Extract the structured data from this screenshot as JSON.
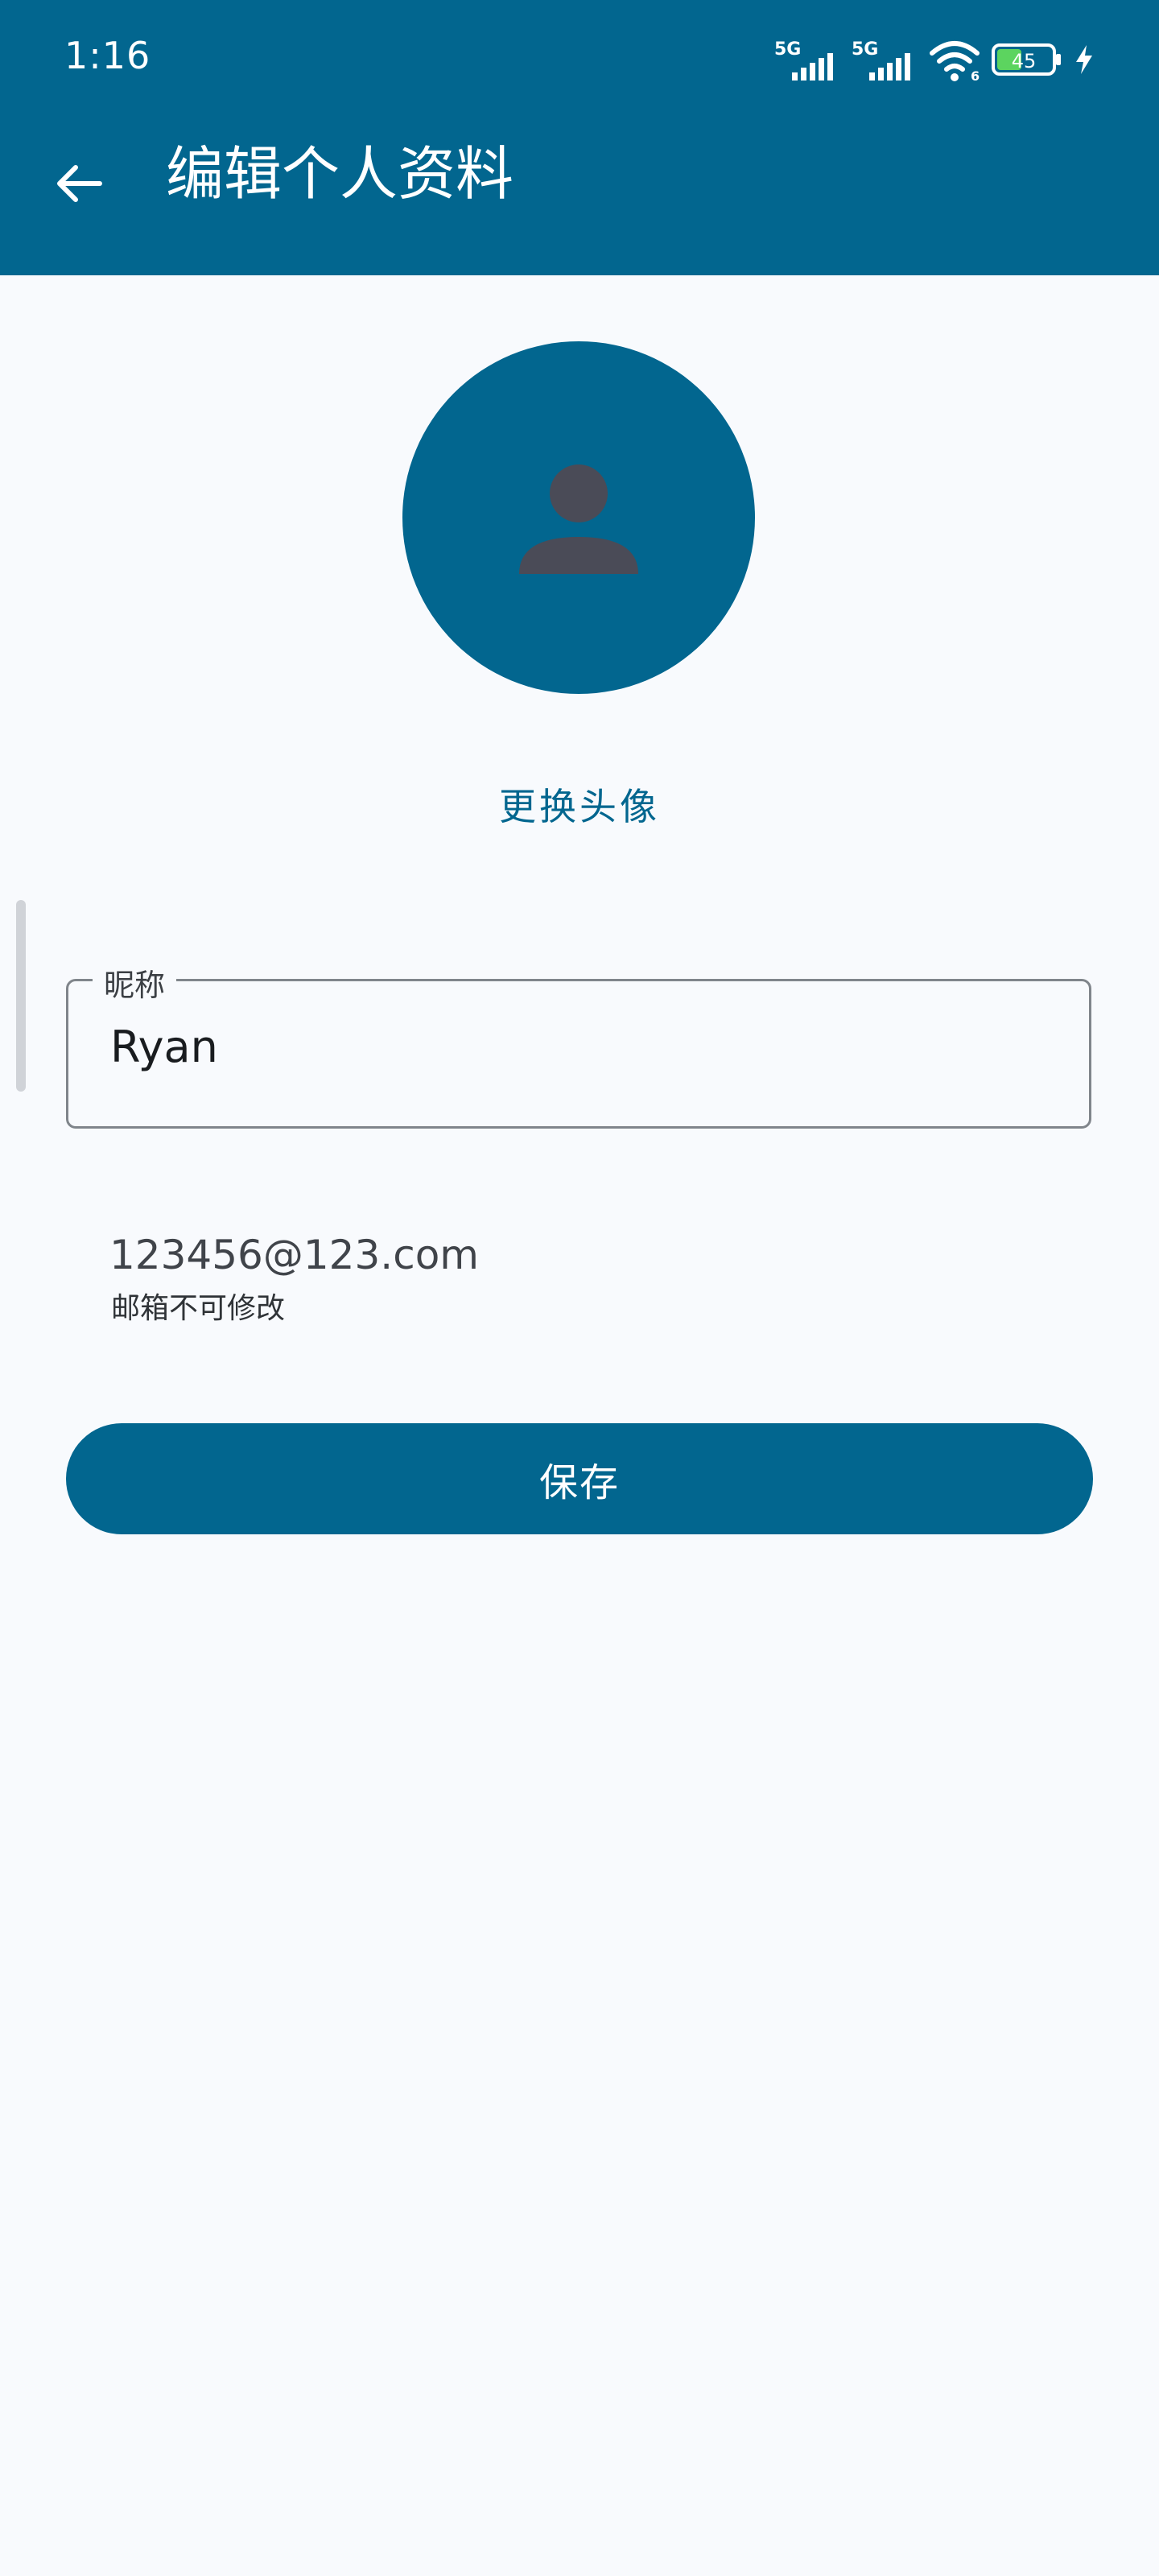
{
  "status_bar": {
    "time": "1:16",
    "network_1": "5G",
    "network_2": "5G",
    "wifi_label": "6",
    "battery_level": "45",
    "icons": [
      "signal-icon",
      "signal-icon",
      "wifi-icon",
      "battery-icon",
      "charging-icon"
    ]
  },
  "app_bar": {
    "title": "编辑个人资料",
    "back_icon": "arrow-left-icon"
  },
  "profile": {
    "avatar_icon": "person-icon",
    "change_avatar_label": "更换头像"
  },
  "form": {
    "nickname_label": "昵称",
    "nickname_value": "Ryan",
    "email_value": "123456@123.com",
    "email_hint": "邮箱不可修改",
    "save_label": "保存"
  },
  "colors": {
    "primary": "#02668f",
    "background": "#f8fafd",
    "avatar_silhouette": "#4a4b57"
  }
}
